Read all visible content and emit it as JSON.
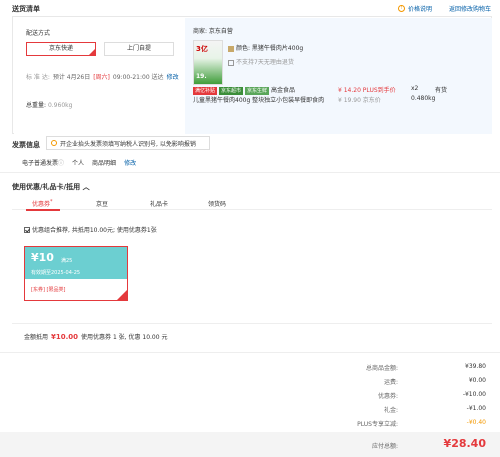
{
  "header": {
    "title": "送货清单",
    "price_info": "价格说明",
    "back_cart": "返回修改购物车"
  },
  "shipping": {
    "method_label": "配送方式",
    "opt_jd": "京东快递",
    "opt_pickup": "上门自提",
    "time_label": "标 准 达:",
    "time_prefix": "预计 4月26日",
    "time_highlight": "[周六]",
    "time_range": "09:00-21:00 送达",
    "modify": "修改",
    "weight_label": "总重量:",
    "weight_value": "0.960kg"
  },
  "product": {
    "seller": "商家: 京东自营",
    "img_text1": "3亿",
    "img_text2": "19.",
    "variant": "颜色: 黑猪午餐肉片400g",
    "no_return": "不支持7天无理由退货",
    "tags": [
      "满亿补贴",
      "京东超市",
      "京东生鲜"
    ],
    "tag_text": "高金食品",
    "name": "儿童黑猪午餐肉400g 整块独立小包装早餐即食肉",
    "price": "¥ 14.20 PLUS到手价",
    "old_price": "¥ 19.90 京东价",
    "qty": "x2",
    "stock": "有货",
    "weight": "0.480kg"
  },
  "invoice": {
    "title": "发票信息",
    "tip": "开企业抬头发票须填写纳税人识别号, 以免影响报销",
    "type": "电子普通发票",
    "person": "个人",
    "detail": "商品明细",
    "modify": "修改"
  },
  "coupons": {
    "title": "使用优惠/礼品卡/抵用",
    "toggle": "︿",
    "tabs": [
      "优惠券",
      "京豆",
      "礼品卡",
      "领货码"
    ],
    "tab_mark": "*",
    "option": "优惠组合推荐, 共抵用10.00元; 使用优惠券1张",
    "coupon": {
      "amount": "¥10",
      "condition": "满25",
      "date": "有效期至2025-04-25",
      "tags": "[东券] [限品类]"
    },
    "summary_label": "金额抵用",
    "summary_amount": "¥10.00",
    "summary_text": "使用优惠券 1 张, 优惠 10.00 元"
  },
  "summary": {
    "rows": [
      {
        "label": "总商品金额:",
        "value": "¥39.80"
      },
      {
        "label": "运费:",
        "value": "¥0.00"
      },
      {
        "label": "优惠券:",
        "value": "-¥10.00"
      },
      {
        "label": "礼金:",
        "value": "-¥1.00"
      },
      {
        "label": "PLUS专享立减:",
        "value": "-¥0.40"
      }
    ],
    "total_label": "应付总额:",
    "total_value": "¥28.40"
  },
  "colors": {
    "accent": "#e4393c",
    "link": "#005ea7",
    "coupon_bg": "#6ccfd1",
    "panel_bg": "#f3f8fe",
    "plus": "#f39800"
  }
}
